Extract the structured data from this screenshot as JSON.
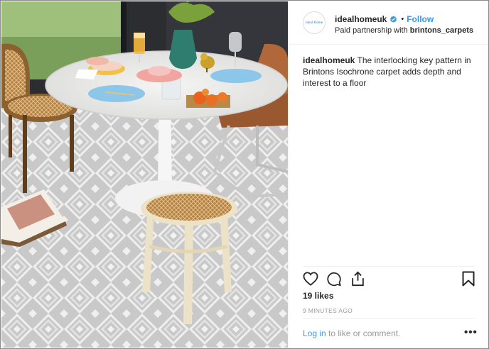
{
  "post": {
    "image_alt": "Dining room with marble table, cane stool and chairs on a grey geometric key-pattern carpet",
    "brand_color": "#3897f0"
  },
  "header": {
    "avatar_text": "Ideal Home",
    "username": "idealhomeuk",
    "verified_icon": "verified-badge-icon",
    "separator": "•",
    "follow_label": "Follow",
    "partnership_prefix": "Paid partnership with",
    "partner": "brintons_carpets"
  },
  "caption": {
    "username": "idealhomeuk",
    "text": "The interlocking key pattern in Brintons Isochrone carpet adds depth and interest to a floor"
  },
  "actions": {
    "icons": [
      "heart-icon",
      "comment-icon",
      "share-icon",
      "bookmark-icon"
    ]
  },
  "stats": {
    "likes": "19 likes",
    "timestamp": "9 MINUTES AGO"
  },
  "footer": {
    "login_label": "Log in",
    "login_suffix": " to like or comment.",
    "more_label": "•••"
  }
}
